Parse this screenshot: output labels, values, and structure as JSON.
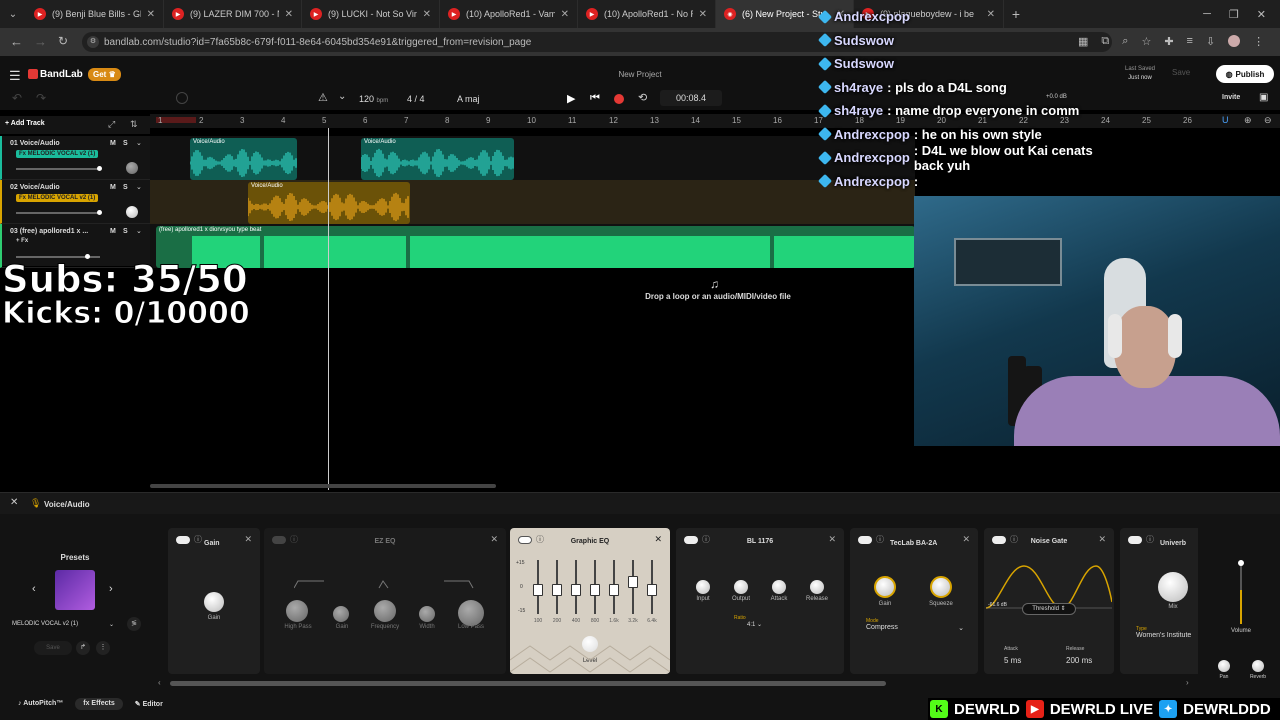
{
  "browser": {
    "tabs": [
      {
        "title": "(9) Benji Blue Bills - Glass"
      },
      {
        "title": "(9) LAZER DIM 700 - NEX"
      },
      {
        "title": "(9) LUCKI - Not So Virgo"
      },
      {
        "title": "(10) ApolloRed1 - Vamp"
      },
      {
        "title": "(10) ApolloRed1 - No Run"
      },
      {
        "title": "(6) New Project - Stu"
      },
      {
        "title": "(9) plaqueboydew - i be"
      }
    ],
    "url": "bandlab.com/studio?id=7fa65b8c-679f-f011-8e64-6045bd354e91&triggered_from=revision_page"
  },
  "app": {
    "logo": "BandLab",
    "get_label": "Get",
    "project_title": "New Project",
    "last_saved_label": "Last Saved",
    "last_saved_value": "Just now",
    "save_label": "Save",
    "publish_label": "Publish",
    "invite_label": "Invite"
  },
  "transport": {
    "bpm": "120",
    "bpm_unit": "bpm",
    "time_sig": "4 / 4",
    "key": "A maj",
    "time": "00:08.4",
    "master_db": "+0.0 dB"
  },
  "toolbar": {
    "add_track_label": "Add Track"
  },
  "ruler": {
    "bars": [
      "1",
      "2",
      "3",
      "4",
      "5",
      "6",
      "7",
      "8",
      "9",
      "10",
      "11",
      "12",
      "13",
      "14",
      "15",
      "16",
      "17",
      "18",
      "19",
      "20",
      "21",
      "22",
      "23",
      "24",
      "25",
      "26"
    ]
  },
  "tracks": [
    {
      "num": "01",
      "name": "Voice/Audio",
      "fx": "Fx MELODIC VOCAL v2 (1)",
      "m": "M",
      "s": "S"
    },
    {
      "num": "02",
      "name": "Voice/Audio",
      "fx": "Fx MELODIC VOCAL v2 (1)",
      "m": "M",
      "s": "S"
    },
    {
      "num": "03",
      "name": "(free) apollored1 x ...",
      "fx": "+ Fx",
      "m": "M",
      "s": "S"
    }
  ],
  "clips": {
    "voice": "Voice/Audio",
    "beat": "(free) apollored1 x diorvsyou type beat"
  },
  "drop_hint": "Drop a loop or an audio/MIDI/video file",
  "overlay": {
    "subs": "Subs: 35/50",
    "kicks": "Kicks: 0/10000"
  },
  "chat": [
    {
      "user": "Andrexcpop",
      "text": ""
    },
    {
      "user": "Sudswow",
      "text": ""
    },
    {
      "user": "Sudswow",
      "text": ""
    },
    {
      "user": "sh4raye",
      "text": ": pls do a D4L song"
    },
    {
      "user": "sh4raye",
      "text": ": name drop everyone in comm"
    },
    {
      "user": "Andrexcpop",
      "text": ": he on his own style"
    },
    {
      "user": "Andrexcpop",
      "text": ": D4L we blow out Kai cenats back yuh"
    },
    {
      "user": "Andrexcpop",
      "text": ":"
    }
  ],
  "bottom": {
    "track_label": "Voice/Audio",
    "presets_title": "Presets",
    "preset_name": "MELODIC VOCAL v2 (1)",
    "save_label": "Save",
    "tabs": [
      "AutoPitch™",
      "Effects",
      "Editor"
    ],
    "plugins": {
      "gain": {
        "title": "Gain",
        "knob": "Gain"
      },
      "ezeq": {
        "title": "EZ EQ",
        "knobs": [
          "High Pass",
          "Gain",
          "Frequency",
          "Width",
          "Low Pass"
        ]
      },
      "geq": {
        "title": "Graphic EQ",
        "bands": [
          "100",
          "200",
          "400",
          "800",
          "1.6k",
          "3.2k",
          "6.4k"
        ],
        "scale": [
          "+15",
          "0",
          "-15"
        ],
        "level_label": "Level"
      },
      "bl1176": {
        "title": "BL 1176",
        "knobs": [
          "Input",
          "Output",
          "Attack",
          "Release"
        ],
        "ratio_label": "Ratio",
        "ratio_value": "4:1"
      },
      "tectab": {
        "title": "TecLab BA-2A",
        "knobs": [
          "Gain",
          "Squeeze"
        ],
        "mode_label": "Mode",
        "mode_value": "Compress"
      },
      "gate": {
        "title": "Noise Gate",
        "threshold_label": "Threshold",
        "db_value": "-61.6 dB",
        "attack_label": "Attack",
        "attack_value": "5 ms",
        "release_label": "Release",
        "release_value": "200 ms"
      },
      "univerb": {
        "title": "Univerb",
        "knob": "Mix",
        "type_label": "Type",
        "type_value": "Women's Institute"
      }
    },
    "volume_label": "Volume",
    "pan_label": "Pan",
    "reverb_label": "Reverb"
  },
  "banner": {
    "kick": "DEWRLD",
    "youtube": "DEWRLD LIVE",
    "twitter": "DEWRLDDD"
  }
}
